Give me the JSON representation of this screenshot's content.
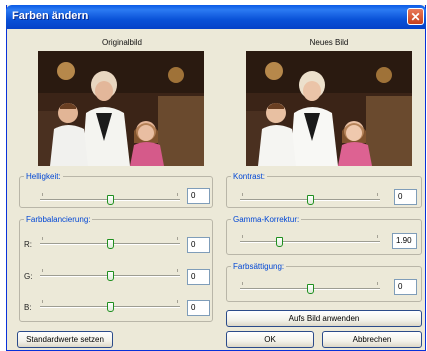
{
  "window": {
    "title": "Farben ändern"
  },
  "preview": {
    "original_label": "Originalbild",
    "new_label": "Neues Bild"
  },
  "brightness": {
    "label": "Helligkeit:",
    "value": "0",
    "level": 0.5
  },
  "color_balance": {
    "label": "Farbbalancierung:",
    "channels": [
      {
        "label": "R:",
        "value": "0",
        "level": 0.5
      },
      {
        "label": "G:",
        "value": "0",
        "level": 0.5
      },
      {
        "label": "B:",
        "value": "0",
        "level": 0.5
      }
    ]
  },
  "contrast": {
    "label": "Kontrast:",
    "value": "0",
    "level": 0.5
  },
  "gamma": {
    "label": "Gamma-Korrektur:",
    "value": "1.90",
    "level": 0.27
  },
  "saturation": {
    "label": "Farbsättigung:",
    "value": "0",
    "level": 0.5
  },
  "buttons": {
    "apply": "Aufs Bild anwenden",
    "defaults": "Standardwerte setzen",
    "ok": "OK",
    "cancel": "Abbrechen"
  },
  "colors": {
    "title_bar": "#0a52d8",
    "dialog_bg": "#ece9d8",
    "group_label": "#0046d5",
    "close_button": "#d0512e",
    "slider_thumb_border": "#1f8f1f"
  }
}
